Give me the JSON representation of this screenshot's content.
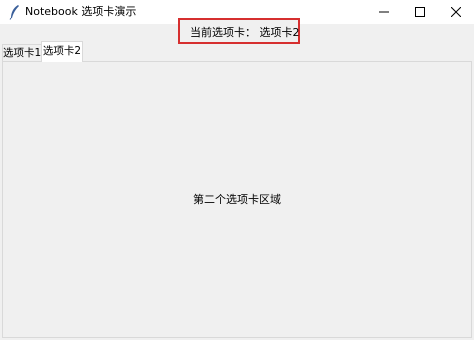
{
  "window": {
    "title": "Notebook 选项卡演示",
    "icon": "feather-icon",
    "controls": [
      "minimize-icon",
      "maximize-icon",
      "close-icon"
    ]
  },
  "status": {
    "text": "当前选项卡：  选项卡2",
    "border_color": "#d62f2f"
  },
  "tabs": [
    {
      "label": "选项卡1",
      "selected": false
    },
    {
      "label": "选项卡2",
      "selected": true
    }
  ],
  "pane": {
    "content": "第二个选项卡区域"
  },
  "colors": {
    "background": "#f0f0f0",
    "titlebar": "#ffffff",
    "tab_border": "#d9d9d9"
  }
}
